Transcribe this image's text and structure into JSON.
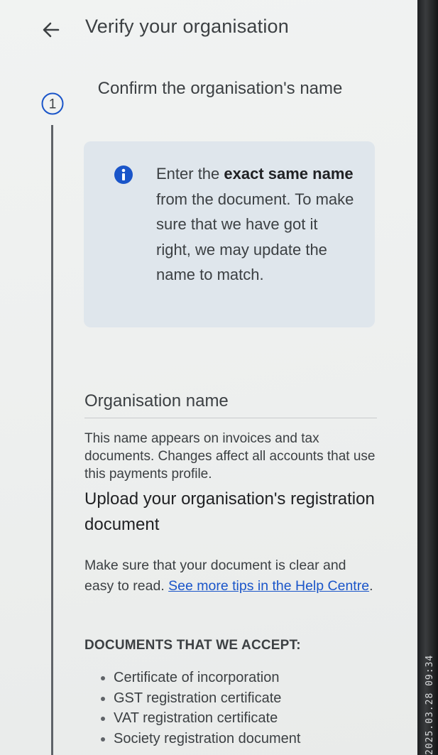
{
  "header": {
    "title": "Verify your organisation",
    "back_icon": "arrow-left-icon"
  },
  "step": {
    "number": "1",
    "title": "Confirm the organisation's name"
  },
  "info": {
    "icon": "info-icon",
    "text_before": "Enter the ",
    "text_bold": "exact same name",
    "text_after": " from the document. To make sure that we have got it right, we may update the name to match.",
    "box_color": "#dfe6ec",
    "icon_color": "#1a55c9"
  },
  "org_name": {
    "label": "Organisation name",
    "value": "",
    "help": "This name appears on invoices and tax documents. Changes affect all accounts that use this payments profile."
  },
  "upload": {
    "title": "Upload your organisation's registration document",
    "desc": "Make sure that your document is clear and easy to read. ",
    "link_text": "See more tips in the Help Centre",
    "link_after": "."
  },
  "documents": {
    "heading": "DOCUMENTS THAT WE ACCEPT:",
    "items": [
      "Certificate of incorporation",
      "GST registration certificate",
      "VAT registration certificate",
      "Society registration document"
    ]
  },
  "bezel": {
    "timestamp": "2025.03.28 09:34"
  }
}
